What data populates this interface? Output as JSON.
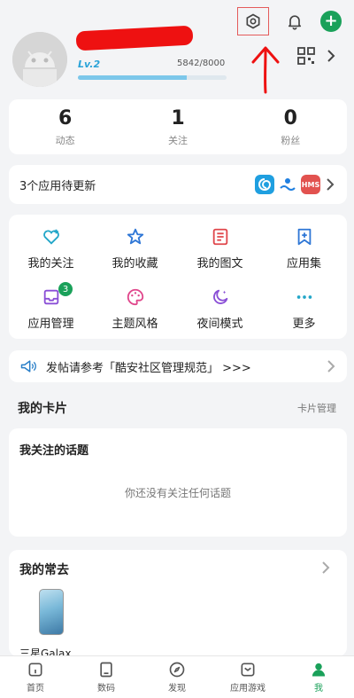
{
  "header": {
    "icons": [
      "settings-icon",
      "bell-icon",
      "plus-icon",
      "qr-code-icon",
      "chevron-right-icon"
    ],
    "plus_label": "+"
  },
  "profile": {
    "level": "Lv.2",
    "xp_text": "5842/8000",
    "xp_progress": 0.73
  },
  "stats": [
    {
      "value": "6",
      "label": "动态"
    },
    {
      "value": "1",
      "label": "关注"
    },
    {
      "value": "0",
      "label": "粉丝"
    }
  ],
  "update": {
    "text": "3个应用待更新",
    "app_icons": [
      "swirl-app-icon",
      "wave-app-icon",
      "hms-app-icon"
    ],
    "hms_label": "HMS"
  },
  "grid": [
    {
      "label": "我的关注",
      "icon": "heart-plus-icon",
      "color": "#22a6c8"
    },
    {
      "label": "我的收藏",
      "icon": "star-icon",
      "color": "#2f77d6"
    },
    {
      "label": "我的图文",
      "icon": "document-icon",
      "color": "#e0474c"
    },
    {
      "label": "应用集",
      "icon": "bookmark-icon",
      "color": "#2f77d6"
    },
    {
      "label": "应用管理",
      "icon": "inbox-icon",
      "color": "#8a4fd6",
      "badge": "3"
    },
    {
      "label": "主题风格",
      "icon": "palette-icon",
      "color": "#e0478c"
    },
    {
      "label": "夜间模式",
      "icon": "moon-icon",
      "color": "#8a4fd6"
    },
    {
      "label": "更多",
      "icon": "more-icon",
      "color": "#22a6c8"
    }
  ],
  "notice": {
    "text": "发帖请参考「酷安社区管理规范」 >>>"
  },
  "cards_section": {
    "title": "我的卡片",
    "manage": "卡片管理"
  },
  "topics": {
    "title": "我关注的话题",
    "empty": "你还没有关注任何话题"
  },
  "frequent": {
    "title": "我的常去",
    "item_label": "三星Galax"
  },
  "nav": [
    {
      "label": "首页",
      "icon": "home-icon"
    },
    {
      "label": "数码",
      "icon": "device-icon"
    },
    {
      "label": "发现",
      "icon": "compass-icon"
    },
    {
      "label": "应用游戏",
      "icon": "app-store-icon"
    },
    {
      "label": "我",
      "icon": "person-icon",
      "active": true
    }
  ],
  "colors": {
    "accent": "#1aa15a",
    "annotation": "#e11"
  }
}
